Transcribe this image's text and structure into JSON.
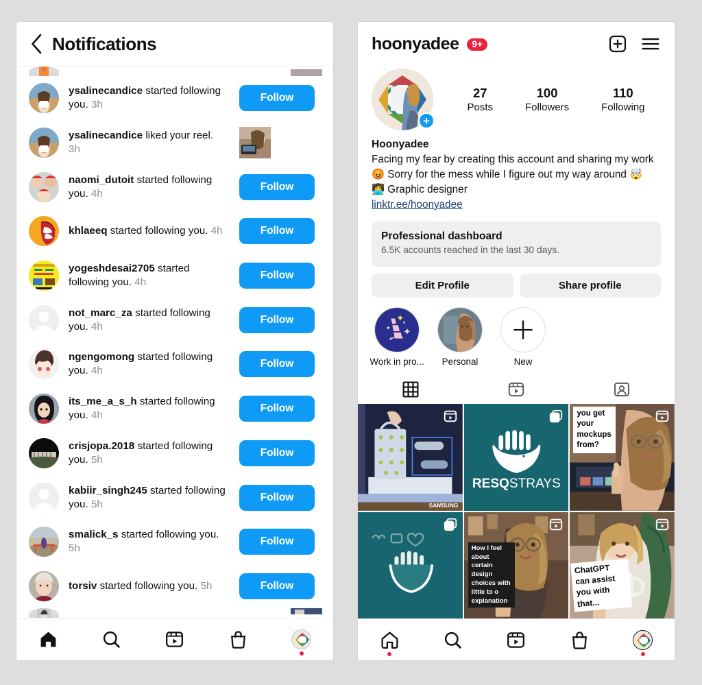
{
  "notifications_screen": {
    "header": {
      "title": "Notifications",
      "back_icon": "chevron-left-icon"
    },
    "items": [
      {
        "username": "ysalinecandice",
        "action": "started following you.",
        "time": "3h",
        "action_type": "follow_button",
        "button_label": "Follow",
        "avatar_kind": "photo-beach"
      },
      {
        "username": "ysalinecandice",
        "action": "liked your reel.",
        "time": "3h",
        "action_type": "thumbnail",
        "avatar_kind": "photo-beach"
      },
      {
        "username": "naomi_dutoit",
        "action": "started following you.",
        "time": "4h",
        "action_type": "follow_button",
        "button_label": "Follow",
        "avatar_kind": "photo-family"
      },
      {
        "username": "khlaeeq",
        "action": "started following you.",
        "time": "4h",
        "action_type": "follow_button",
        "button_label": "Follow",
        "avatar_kind": "spiderman"
      },
      {
        "username": "yogeshdesai2705",
        "action": "started following you.",
        "time": "4h",
        "action_type": "follow_button",
        "button_label": "Follow",
        "avatar_kind": "yellow-poster"
      },
      {
        "username": "not_marc_za",
        "action": "started following you.",
        "time": "4h",
        "action_type": "follow_button",
        "button_label": "Follow",
        "avatar_kind": "default"
      },
      {
        "username": "ngengomong",
        "action": "started following you.",
        "time": "4h",
        "action_type": "follow_button",
        "button_label": "Follow",
        "avatar_kind": "anime"
      },
      {
        "username": "its_me_a_s_h",
        "action": "started following you.",
        "time": "4h",
        "action_type": "follow_button",
        "button_label": "Follow",
        "avatar_kind": "illustration-woman"
      },
      {
        "username": "crisjopa.2018",
        "action": "started following you.",
        "time": "5h",
        "action_type": "follow_button",
        "button_label": "Follow",
        "avatar_kind": "dark-landscape"
      },
      {
        "username": "kabiir_singh245",
        "action": "started following you.",
        "time": "5h",
        "action_type": "follow_button",
        "button_label": "Follow",
        "avatar_kind": "default"
      },
      {
        "username": "smalick_s",
        "action": "started following you.",
        "time": "5h",
        "action_type": "follow_button",
        "button_label": "Follow",
        "avatar_kind": "photo-outdoor"
      },
      {
        "username": "torsiv",
        "action": "started following you.",
        "time": "5h",
        "action_type": "follow_button",
        "button_label": "Follow",
        "avatar_kind": "photo-woman"
      }
    ],
    "bottom_nav": [
      {
        "icon": "home-icon",
        "state": "active-filled"
      },
      {
        "icon": "search-icon",
        "state": "default"
      },
      {
        "icon": "reels-icon",
        "state": "default"
      },
      {
        "icon": "shop-icon",
        "state": "default"
      },
      {
        "icon": "profile-avatar-icon",
        "state": "has-notification-dot"
      }
    ]
  },
  "profile_screen": {
    "header": {
      "username": "hoonyadee",
      "badge": "9+",
      "badge_color": "#e8233d",
      "add_icon": "plus-square-icon",
      "menu_icon": "hamburger-menu-icon"
    },
    "stats": [
      {
        "value": "27",
        "label": "Posts"
      },
      {
        "value": "100",
        "label": "Followers"
      },
      {
        "value": "110",
        "label": "Following"
      }
    ],
    "avatar": {
      "add_story_icon": "plus-circle-icon"
    },
    "bio": {
      "display_name": "Hoonyadee",
      "line1": "Facing my fear by creating this account and sharing my work",
      "line2": "😡 Sorry for the mess while I figure out my way around 🤯",
      "line3": "👩‍💻 Graphic designer",
      "link": "linktr.ee/hoonyadee"
    },
    "dashboard": {
      "title": "Professional dashboard",
      "subtitle": "6.5K accounts reached in the last 30 days."
    },
    "actions": [
      {
        "label": "Edit Profile"
      },
      {
        "label": "Share profile"
      }
    ],
    "highlights": [
      {
        "label": "Work in pro...",
        "kind": "merry-navy"
      },
      {
        "label": "Personal",
        "kind": "photo-portrait"
      },
      {
        "label": "New",
        "kind": "plus"
      }
    ],
    "tabs": [
      {
        "icon": "grid-icon",
        "selected": true
      },
      {
        "icon": "reels-icon",
        "selected": false
      },
      {
        "icon": "tagged-icon",
        "selected": false
      }
    ],
    "grid": [
      {
        "kind": "mockup-tote",
        "badge": "reels-icon",
        "caption": "",
        "brand_text": "SAMSUNG"
      },
      {
        "kind": "teal-logo",
        "badge": "carousel-icon",
        "logo_text_bold": "RESQ",
        "logo_text_light": "STRAYS"
      },
      {
        "kind": "person-glasses",
        "badge": "reels-icon",
        "caption": "you get your mockups from?"
      },
      {
        "kind": "teal-logo-plain",
        "badge": "carousel-icon",
        "logo_text_bold": "",
        "logo_text_light": ""
      },
      {
        "kind": "person-desk",
        "badge": "reels-icon",
        "caption": "How I feel about certain design choices with little to o explanation"
      },
      {
        "kind": "person-mug",
        "badge": "reels-icon",
        "caption": "ChatGPT can assist you with that..."
      }
    ],
    "bottom_nav": [
      {
        "icon": "home-icon",
        "state": "has-notification-dot"
      },
      {
        "icon": "search-icon",
        "state": "default"
      },
      {
        "icon": "reels-icon",
        "state": "default"
      },
      {
        "icon": "shop-icon",
        "state": "default"
      },
      {
        "icon": "profile-avatar-icon",
        "state": "active-has-dot"
      }
    ]
  },
  "colors": {
    "accent_blue": "#0f9bf5",
    "badge_red": "#e8233d",
    "teal_post": "#17656e",
    "page_background": "#dedede",
    "muted_text": "#8e8e8e",
    "chip_background": "#efefef"
  }
}
